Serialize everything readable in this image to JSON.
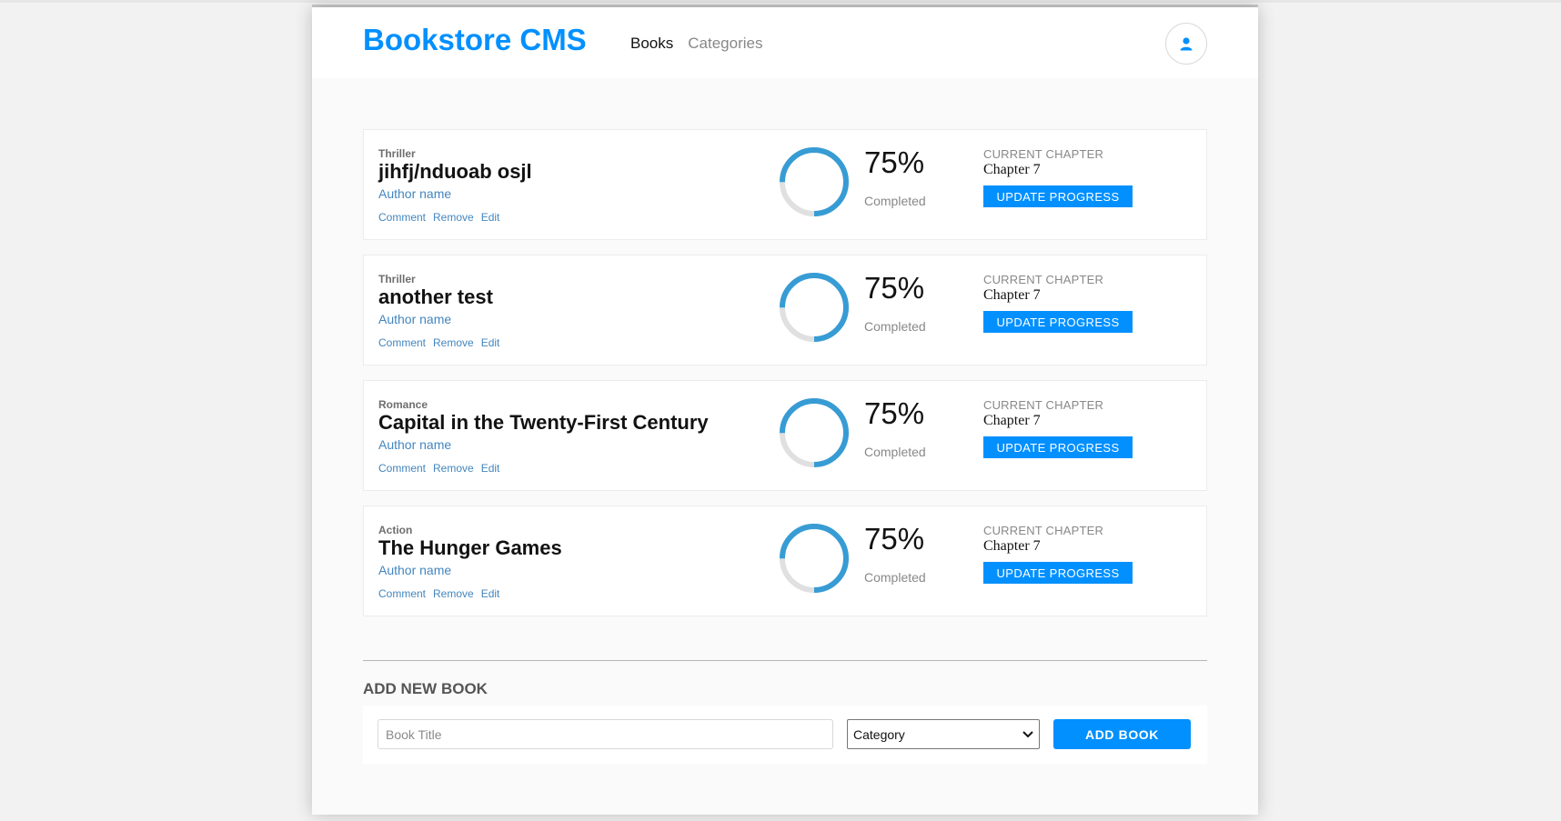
{
  "app": {
    "logo": "Bookstore CMS",
    "nav": {
      "books": "Books",
      "categories": "Categories"
    },
    "accent_color": "#0290ff",
    "avatar_icon": "user-icon"
  },
  "books": [
    {
      "genre": "Thriller",
      "title": "jihfj/nduoab osjl",
      "author": "Author name",
      "progress": 0.75,
      "percent": "75%",
      "completed": "Completed",
      "chapter_label": "CURRENT CHAPTER",
      "chapter": "Chapter 7",
      "update_label": "UPDATE PROGRESS",
      "actions": {
        "comment": "Comment",
        "remove": "Remove",
        "edit": "Edit"
      }
    },
    {
      "genre": "Thriller",
      "title": "another test",
      "author": "Author name",
      "progress": 0.75,
      "percent": "75%",
      "completed": "Completed",
      "chapter_label": "CURRENT CHAPTER",
      "chapter": "Chapter 7",
      "update_label": "UPDATE PROGRESS",
      "actions": {
        "comment": "Comment",
        "remove": "Remove",
        "edit": "Edit"
      }
    },
    {
      "genre": "Romance",
      "title": "Capital in the Twenty-First Century",
      "author": "Author name",
      "progress": 0.75,
      "percent": "75%",
      "completed": "Completed",
      "chapter_label": "CURRENT CHAPTER",
      "chapter": "Chapter 7",
      "update_label": "UPDATE PROGRESS",
      "actions": {
        "comment": "Comment",
        "remove": "Remove",
        "edit": "Edit"
      }
    },
    {
      "genre": "Action",
      "title": "The Hunger Games",
      "author": "Author name",
      "progress": 0.75,
      "percent": "75%",
      "completed": "Completed",
      "chapter_label": "CURRENT CHAPTER",
      "chapter": "Chapter 7",
      "update_label": "UPDATE PROGRESS",
      "actions": {
        "comment": "Comment",
        "remove": "Remove",
        "edit": "Edit"
      }
    }
  ],
  "form": {
    "heading": "ADD NEW BOOK",
    "title_placeholder": "Book Title",
    "title_value": "",
    "category_selected": "Category",
    "submit_label": "ADD BOOK"
  },
  "colors": {
    "progress_ring": "#379cd4",
    "ring_track": "#e0e0e0",
    "link": "#4386bf"
  }
}
